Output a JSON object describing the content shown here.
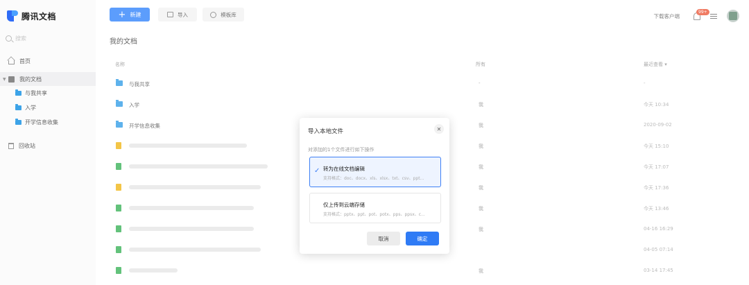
{
  "app": {
    "name": "腾讯文档"
  },
  "sidebar": {
    "search_placeholder": "搜索",
    "home": "首页",
    "my_docs": "我的文档",
    "sub_items": [
      "与我共享",
      "入学",
      "开学信息收集"
    ],
    "trash": "回收站"
  },
  "toolbar": {
    "new_label": "新建",
    "import_label": "导入",
    "templates_label": "模板库",
    "download_client": "下载客户端",
    "notification_badge": "99+"
  },
  "main": {
    "page_title": "我的文档",
    "columns": {
      "name": "名称",
      "owner": "所有",
      "time": "最近查看 ▾"
    },
    "rows": [
      {
        "type": "folder",
        "name": "与我共享",
        "owner": "-",
        "time": "-"
      },
      {
        "type": "folder",
        "name": "入学",
        "owner": "我",
        "time": "今天 10:34"
      },
      {
        "type": "folder",
        "name": "开学信息收集",
        "owner": "我",
        "time": "2020-09-02"
      },
      {
        "type": "doc",
        "name": "",
        "owner": "我",
        "time": "今天 15:10"
      },
      {
        "type": "sheet",
        "name": "",
        "owner": "我",
        "time": "今天 17:07"
      },
      {
        "type": "doc",
        "name": "",
        "owner": "我",
        "time": "今天 17:36"
      },
      {
        "type": "sheet",
        "name": "",
        "owner": "我",
        "time": "今天 13:46"
      },
      {
        "type": "sheet",
        "name": "",
        "owner": "我",
        "time": "04-16 16:29"
      },
      {
        "type": "sheet",
        "name": "",
        "owner": "",
        "time": "04-05 07:14"
      },
      {
        "type": "sheet",
        "name": "",
        "owner": "我",
        "time": "03-14 17:45"
      }
    ]
  },
  "modal": {
    "title": "导入本地文件",
    "subtitle": "对添加的1个文件进行如下操作",
    "option1": {
      "title": "转为在线文档编辑",
      "desc": "支持格式：doc、docx、xls、xlsx、txt、csv、ppt..."
    },
    "option2": {
      "title": "仅上传到云端存储",
      "desc": "支持格式：pptx、ppt、pot、potx、pps、ppsx、c..."
    },
    "cancel": "取消",
    "confirm": "确定"
  }
}
